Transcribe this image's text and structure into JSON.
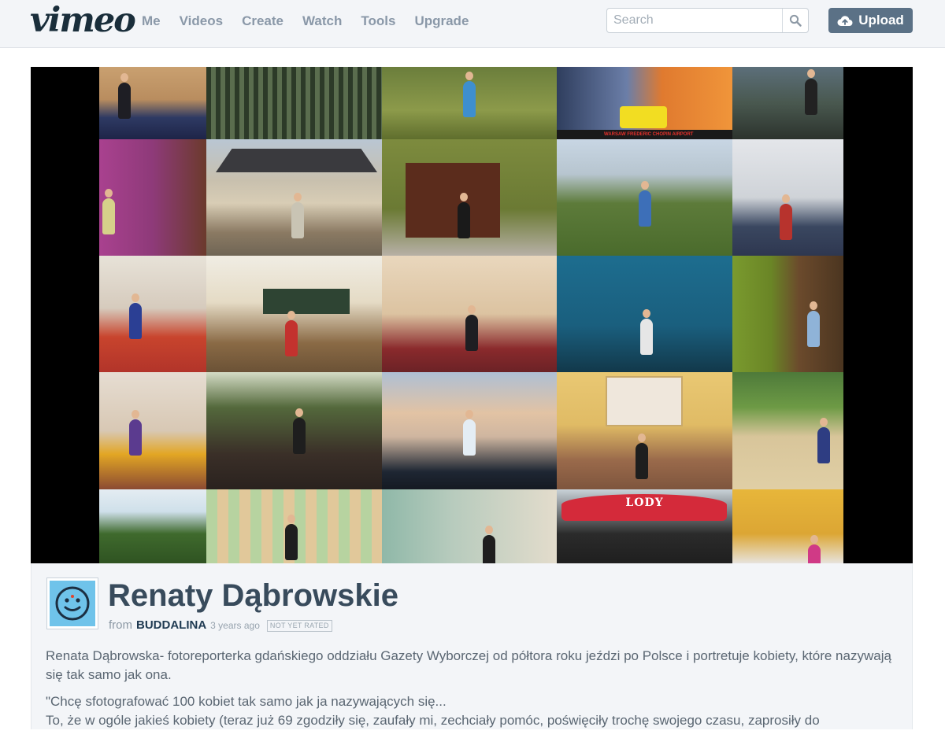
{
  "brand": {
    "logo_text": "vimeo"
  },
  "nav": {
    "items": [
      {
        "label": "Me"
      },
      {
        "label": "Videos"
      },
      {
        "label": "Create"
      },
      {
        "label": "Watch"
      },
      {
        "label": "Tools"
      },
      {
        "label": "Upgrade"
      }
    ]
  },
  "search": {
    "placeholder": "Search",
    "value": ""
  },
  "upload": {
    "label": "Upload"
  },
  "colors": {
    "topbar_bg": "#f3f5f8",
    "nav_text": "#8a98a8",
    "upload_bg": "#5b7186",
    "title_text": "#384b5c",
    "username_text": "#1f3a52",
    "avatar_bg": "#6fc3ea"
  },
  "player": {
    "mosaic_overlay_text": {
      "airport_sign": "WARSAW FREDERIC CHOPIN AIRPORT",
      "umbrella_sign": "LODY"
    }
  },
  "video": {
    "title": "Renaty Dąbrowskie",
    "from_label": "from",
    "username": "BUDDALINA",
    "time_ago": "3 years ago",
    "rating": "NOT YET RATED",
    "description": [
      "Renata Dąbrowska- fotoreporterka gdańskiego oddziału Gazety Wyborczej od półtora roku jeździ po Polsce i portretuje kobiety, które nazywają się tak samo jak ona.",
      "\"Chcę sfotografować 100 kobiet tak samo jak ja nazywających się...",
      "To, że w ogóle jakieś kobiety (teraz już 69 zgodziły się, zaufały mi, zechciały pomóc, poświęciły trochę swojego czasu, zaprosiły do"
    ]
  }
}
